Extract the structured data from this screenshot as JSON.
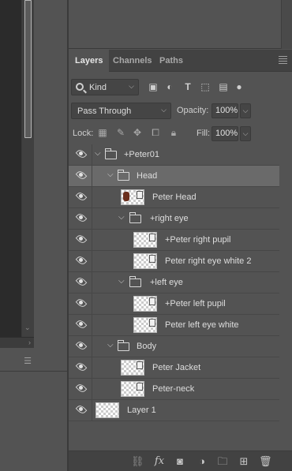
{
  "tabs": [
    {
      "label": "Layers",
      "active": true
    },
    {
      "label": "Channels",
      "active": false
    },
    {
      "label": "Paths",
      "active": false
    }
  ],
  "filter": {
    "kind_label": "Kind"
  },
  "blend": {
    "mode": "Pass Through",
    "opacity_label": "Opacity:",
    "opacity": "100%"
  },
  "lock": {
    "label": "Lock:",
    "fill_label": "Fill:",
    "fill": "100%"
  },
  "layers": [
    {
      "name": "+Peter01",
      "type": "group",
      "expanded": true,
      "selected": false
    },
    {
      "name": "Head",
      "type": "group",
      "expanded": true,
      "selected": true
    },
    {
      "name": "Peter Head",
      "type": "smart-object",
      "selected": false
    },
    {
      "name": "+right eye",
      "type": "group",
      "expanded": true,
      "selected": false
    },
    {
      "name": "+Peter right pupil",
      "type": "smart-object",
      "selected": false
    },
    {
      "name": "Peter right eye white 2",
      "type": "smart-object",
      "selected": false
    },
    {
      "name": "+left eye",
      "type": "group",
      "expanded": true,
      "selected": false
    },
    {
      "name": "+Peter left pupil",
      "type": "smart-object",
      "selected": false
    },
    {
      "name": "Peter left eye white",
      "type": "smart-object",
      "selected": false
    },
    {
      "name": "Body",
      "type": "group",
      "expanded": true,
      "selected": false
    },
    {
      "name": "Peter Jacket",
      "type": "smart-object",
      "selected": false
    },
    {
      "name": "Peter-neck",
      "type": "smart-object",
      "selected": false
    },
    {
      "name": "Layer 1",
      "type": "pixel",
      "selected": false
    }
  ],
  "bottom_icons": [
    "link-icon",
    "fx-icon",
    "mask-icon",
    "adjustment-icon",
    "folder-icon",
    "new-layer-icon",
    "trash-icon"
  ],
  "colors": {
    "panel": "#535353",
    "tabbar": "#424242",
    "selected_row": "#6a6a6a",
    "left_dark": "#2b2b2b"
  }
}
